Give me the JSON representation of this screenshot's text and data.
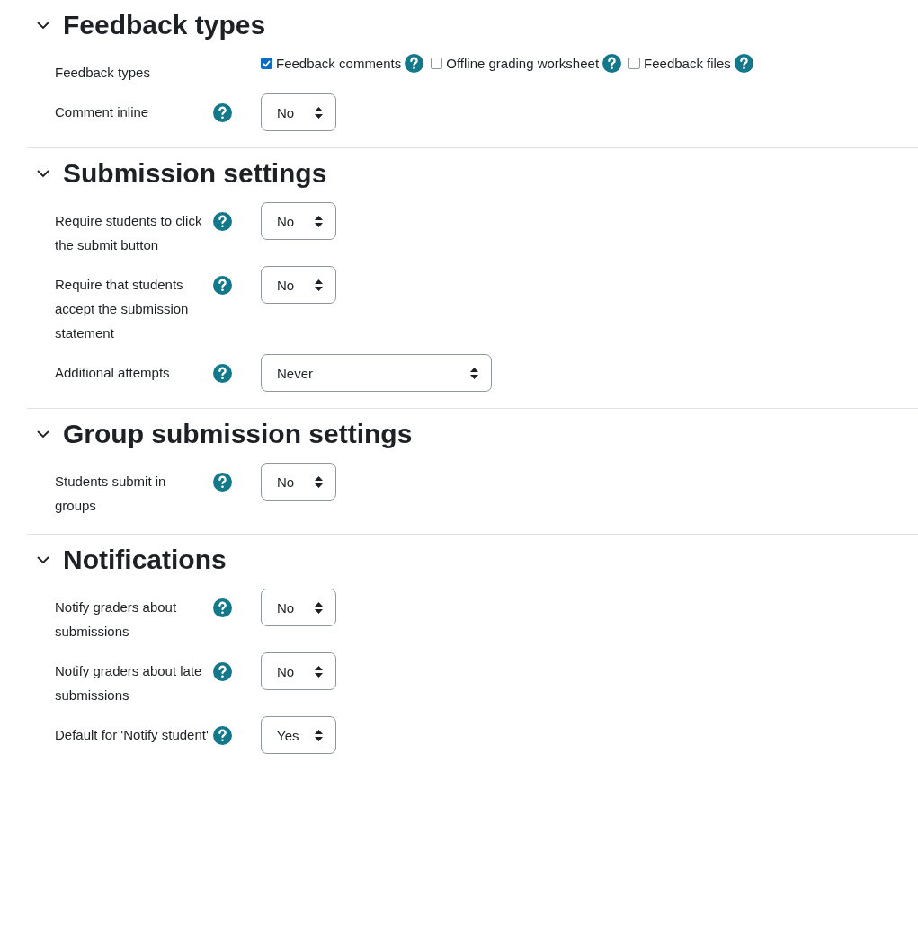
{
  "sections": [
    {
      "title": "Feedback types",
      "expanded": true,
      "fields": [
        {
          "kind": "checkboxes",
          "label": "Feedback types",
          "options": [
            {
              "label": "Feedback comments",
              "checked": true
            },
            {
              "label": "Offline grading worksheet",
              "checked": false
            },
            {
              "label": "Feedback files",
              "checked": false
            }
          ]
        },
        {
          "kind": "select",
          "label": "Comment inline",
          "value": "No"
        }
      ]
    },
    {
      "title": "Submission settings",
      "expanded": true,
      "fields": [
        {
          "kind": "select",
          "label": "Require students to click the submit button",
          "value": "No"
        },
        {
          "kind": "select",
          "label": "Require that students accept the submission statement",
          "value": "No"
        },
        {
          "kind": "wide-select",
          "label": "Additional attempts",
          "value": "Never"
        }
      ]
    },
    {
      "title": "Group submission settings",
      "expanded": true,
      "fields": [
        {
          "kind": "select",
          "label": "Students submit in groups",
          "value": "No"
        }
      ]
    },
    {
      "title": "Notifications",
      "expanded": true,
      "fields": [
        {
          "kind": "select",
          "label": "Notify graders about submissions",
          "value": "No"
        },
        {
          "kind": "select",
          "label": "Notify graders about late submissions",
          "value": "No"
        },
        {
          "kind": "select",
          "label": "Default for 'Notify student'",
          "value": "Yes"
        }
      ]
    }
  ]
}
